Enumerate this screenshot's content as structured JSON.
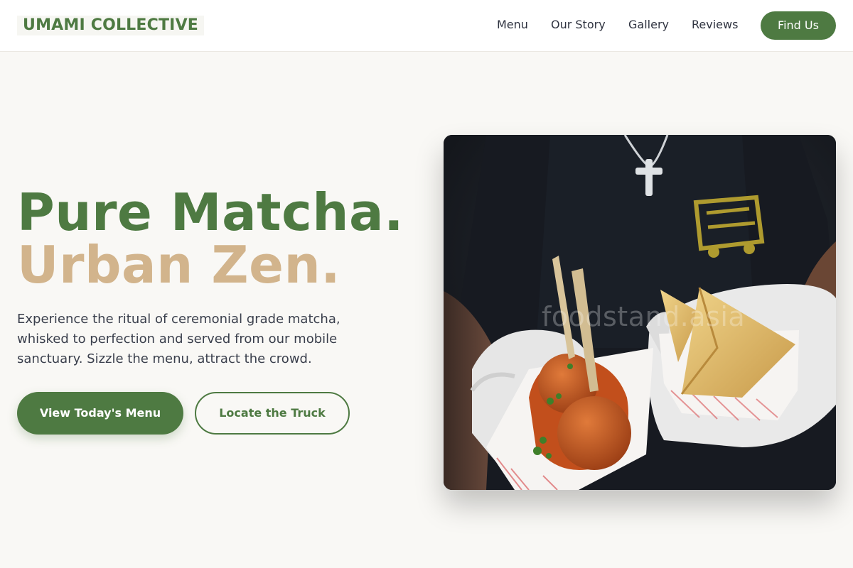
{
  "brand": {
    "name": "UMAMI COLLECTIVE"
  },
  "nav": {
    "links": [
      "Menu",
      "Our Story",
      "Gallery",
      "Reviews"
    ],
    "cta": "Find Us"
  },
  "hero": {
    "title_line1": "Pure Matcha.",
    "title_line2": "Urban Zen.",
    "description": "Experience the ritual of ceremonial grade matcha, whisked to perfection and served from our mobile sanctuary. Sizzle the menu, attract the crowd.",
    "primary_button": "View Today's Menu",
    "secondary_button": "Locate the Truck",
    "image_watermark": "foodstand.asia"
  },
  "colors": {
    "brand_green": "#4e7a42",
    "accent_tan": "#d2b48c",
    "page_background": "#f9f8f5"
  }
}
